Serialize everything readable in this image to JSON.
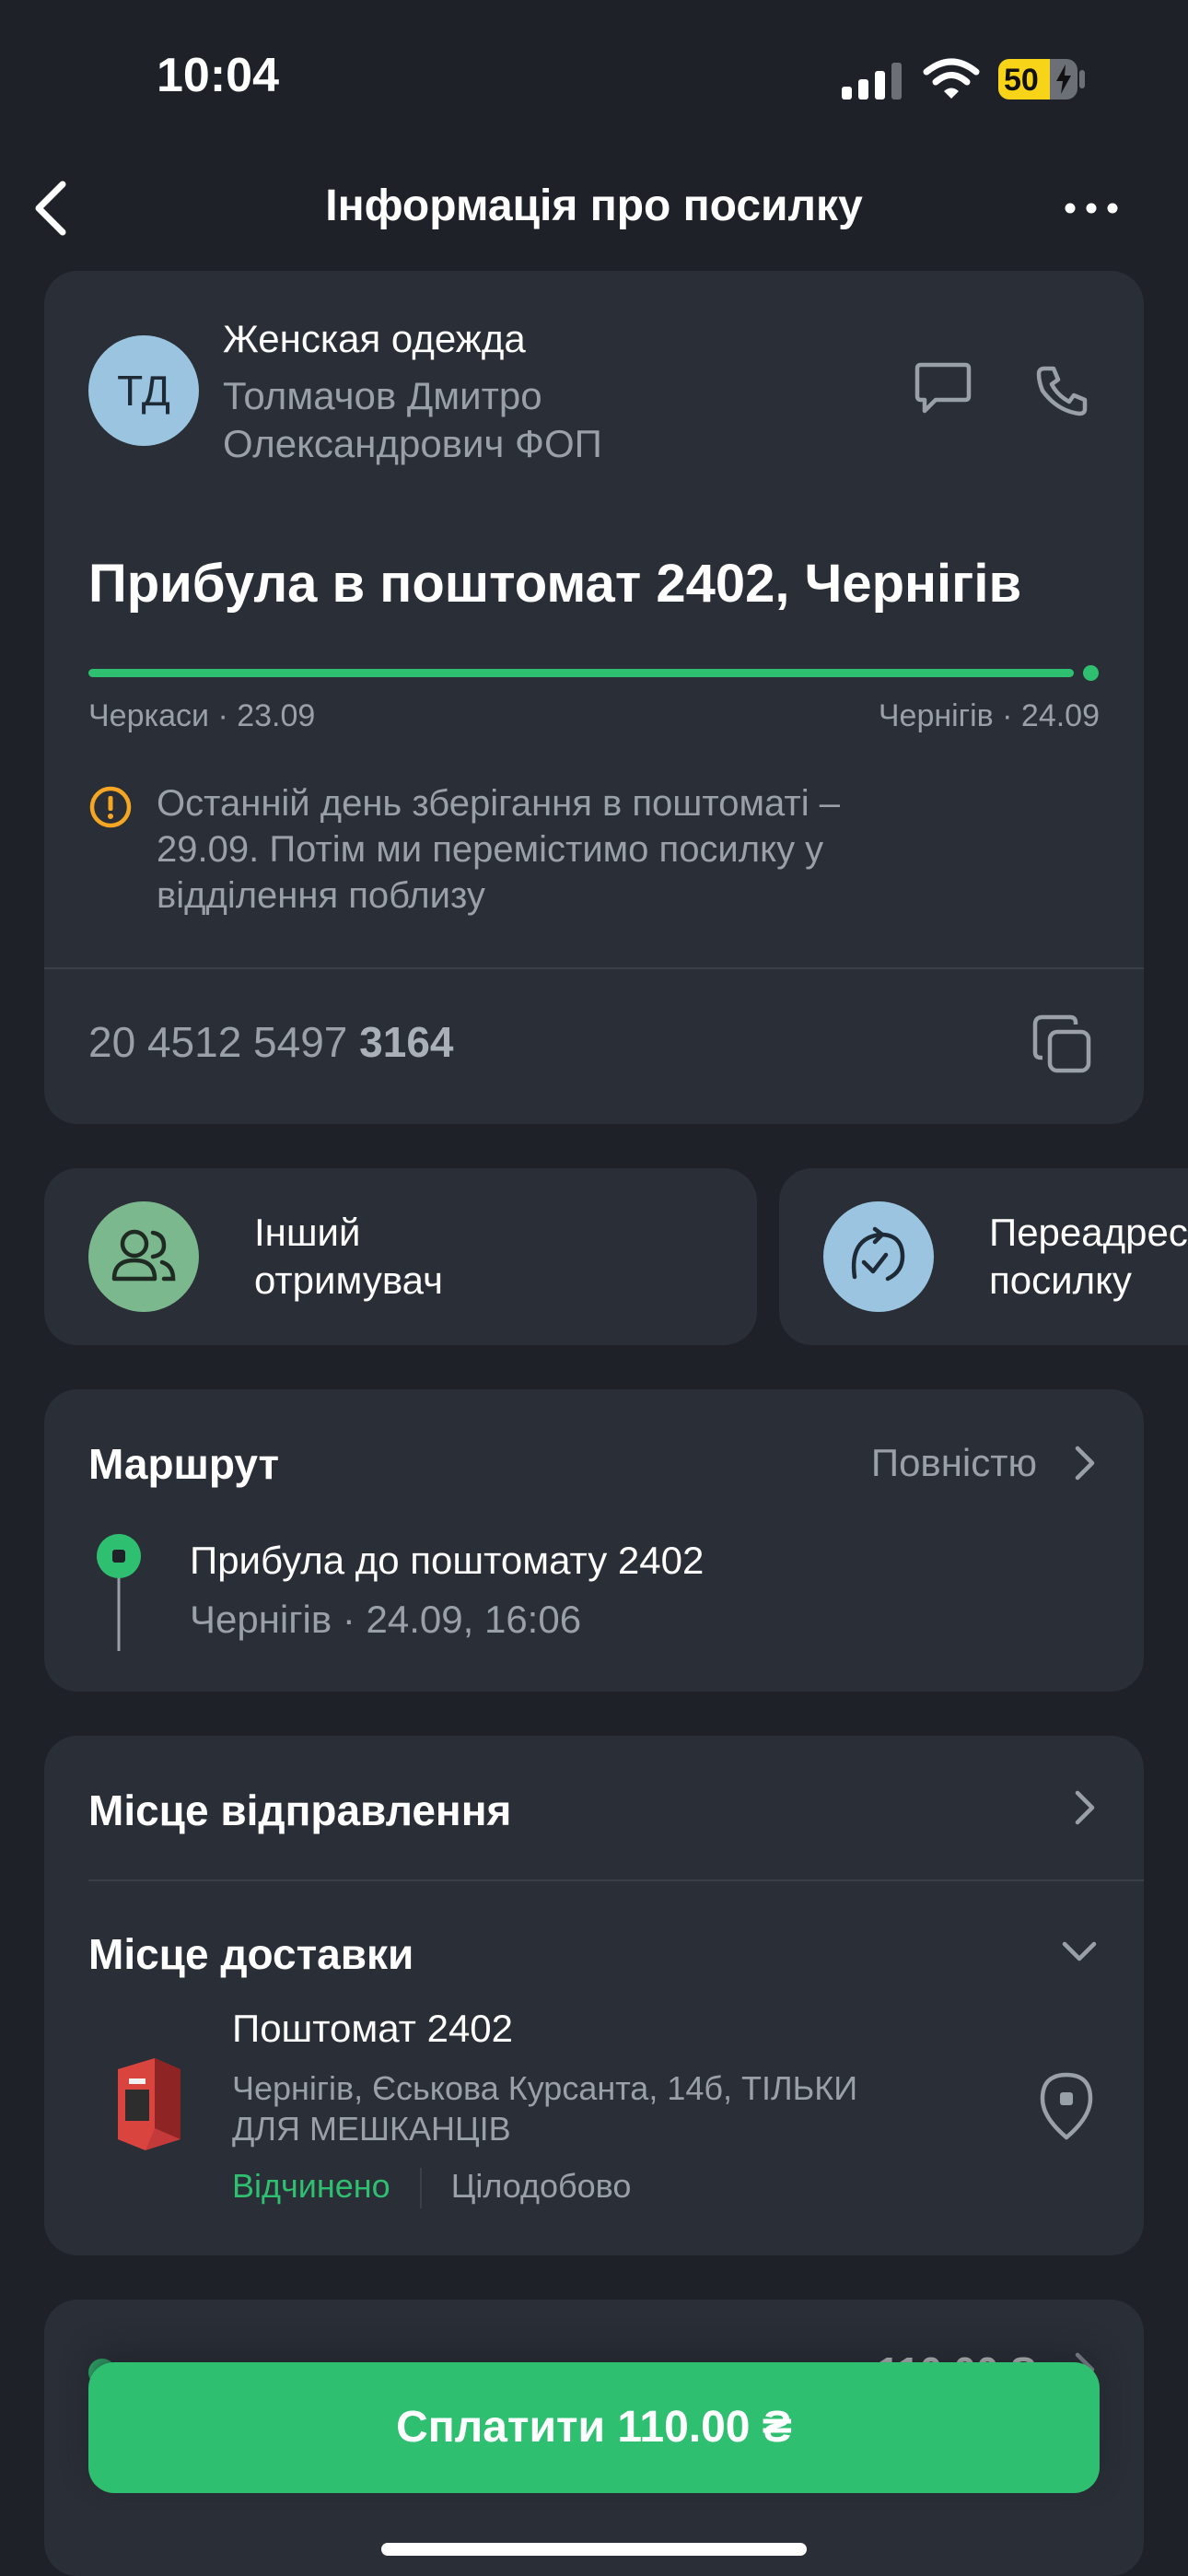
{
  "status_bar": {
    "time": "10:04",
    "battery": "50"
  },
  "nav": {
    "title": "Інформація про посилку"
  },
  "sender": {
    "avatar_initials": "ТД",
    "shop_name": "Женская одежда",
    "person_line1": "Толмачов Дмитро",
    "person_line2": "Олександрович ФОП"
  },
  "status": {
    "headline": "Прибула в поштомат 2402, Чернігів",
    "progress": 1.0,
    "from_label": "Черкаси · 23.09",
    "to_label": "Чернігів · 24.09",
    "warning_line1": "Останній день зберігання в поштоматі –",
    "warning_line2": "29.09. Потім ми перемістимо посилку у",
    "warning_line3": "відділення поблизу"
  },
  "tracking": {
    "number_main": "20 4512 5497",
    "number_tail": "3164"
  },
  "actions": [
    {
      "label_line1": "Інший",
      "label_line2": "отримувач",
      "icon": "users-icon"
    },
    {
      "label_line1": "Переадрес",
      "label_line2": "посилку",
      "icon": "redirect-icon"
    }
  ],
  "route": {
    "title": "Маршрут",
    "full_link": "Повністю",
    "event_title": "Прибула до поштомату 2402",
    "event_subtitle": "Чернігів · 24.09, 16:06"
  },
  "places": {
    "departure_label": "Місце відправлення",
    "delivery_label": "Місце доставки",
    "locker_name": "Поштомат 2402",
    "locker_address_line1": "Чернігів, Єськова Курсанта, 14б, ТІЛЬКИ",
    "locker_address_line2": "ДЛЯ МЕШКАНЦІВ",
    "open_status": "Відчинено",
    "hours": "Цілодобово"
  },
  "payment": {
    "partial_amount": "110.00 ₴",
    "pay_button": "Сплатити 110.00 ₴"
  },
  "colors": {
    "accent": "#2fbf71",
    "background": "#1e2228",
    "card": "#2a2e36",
    "warning": "#f5a623",
    "battery": "#f7d417"
  }
}
